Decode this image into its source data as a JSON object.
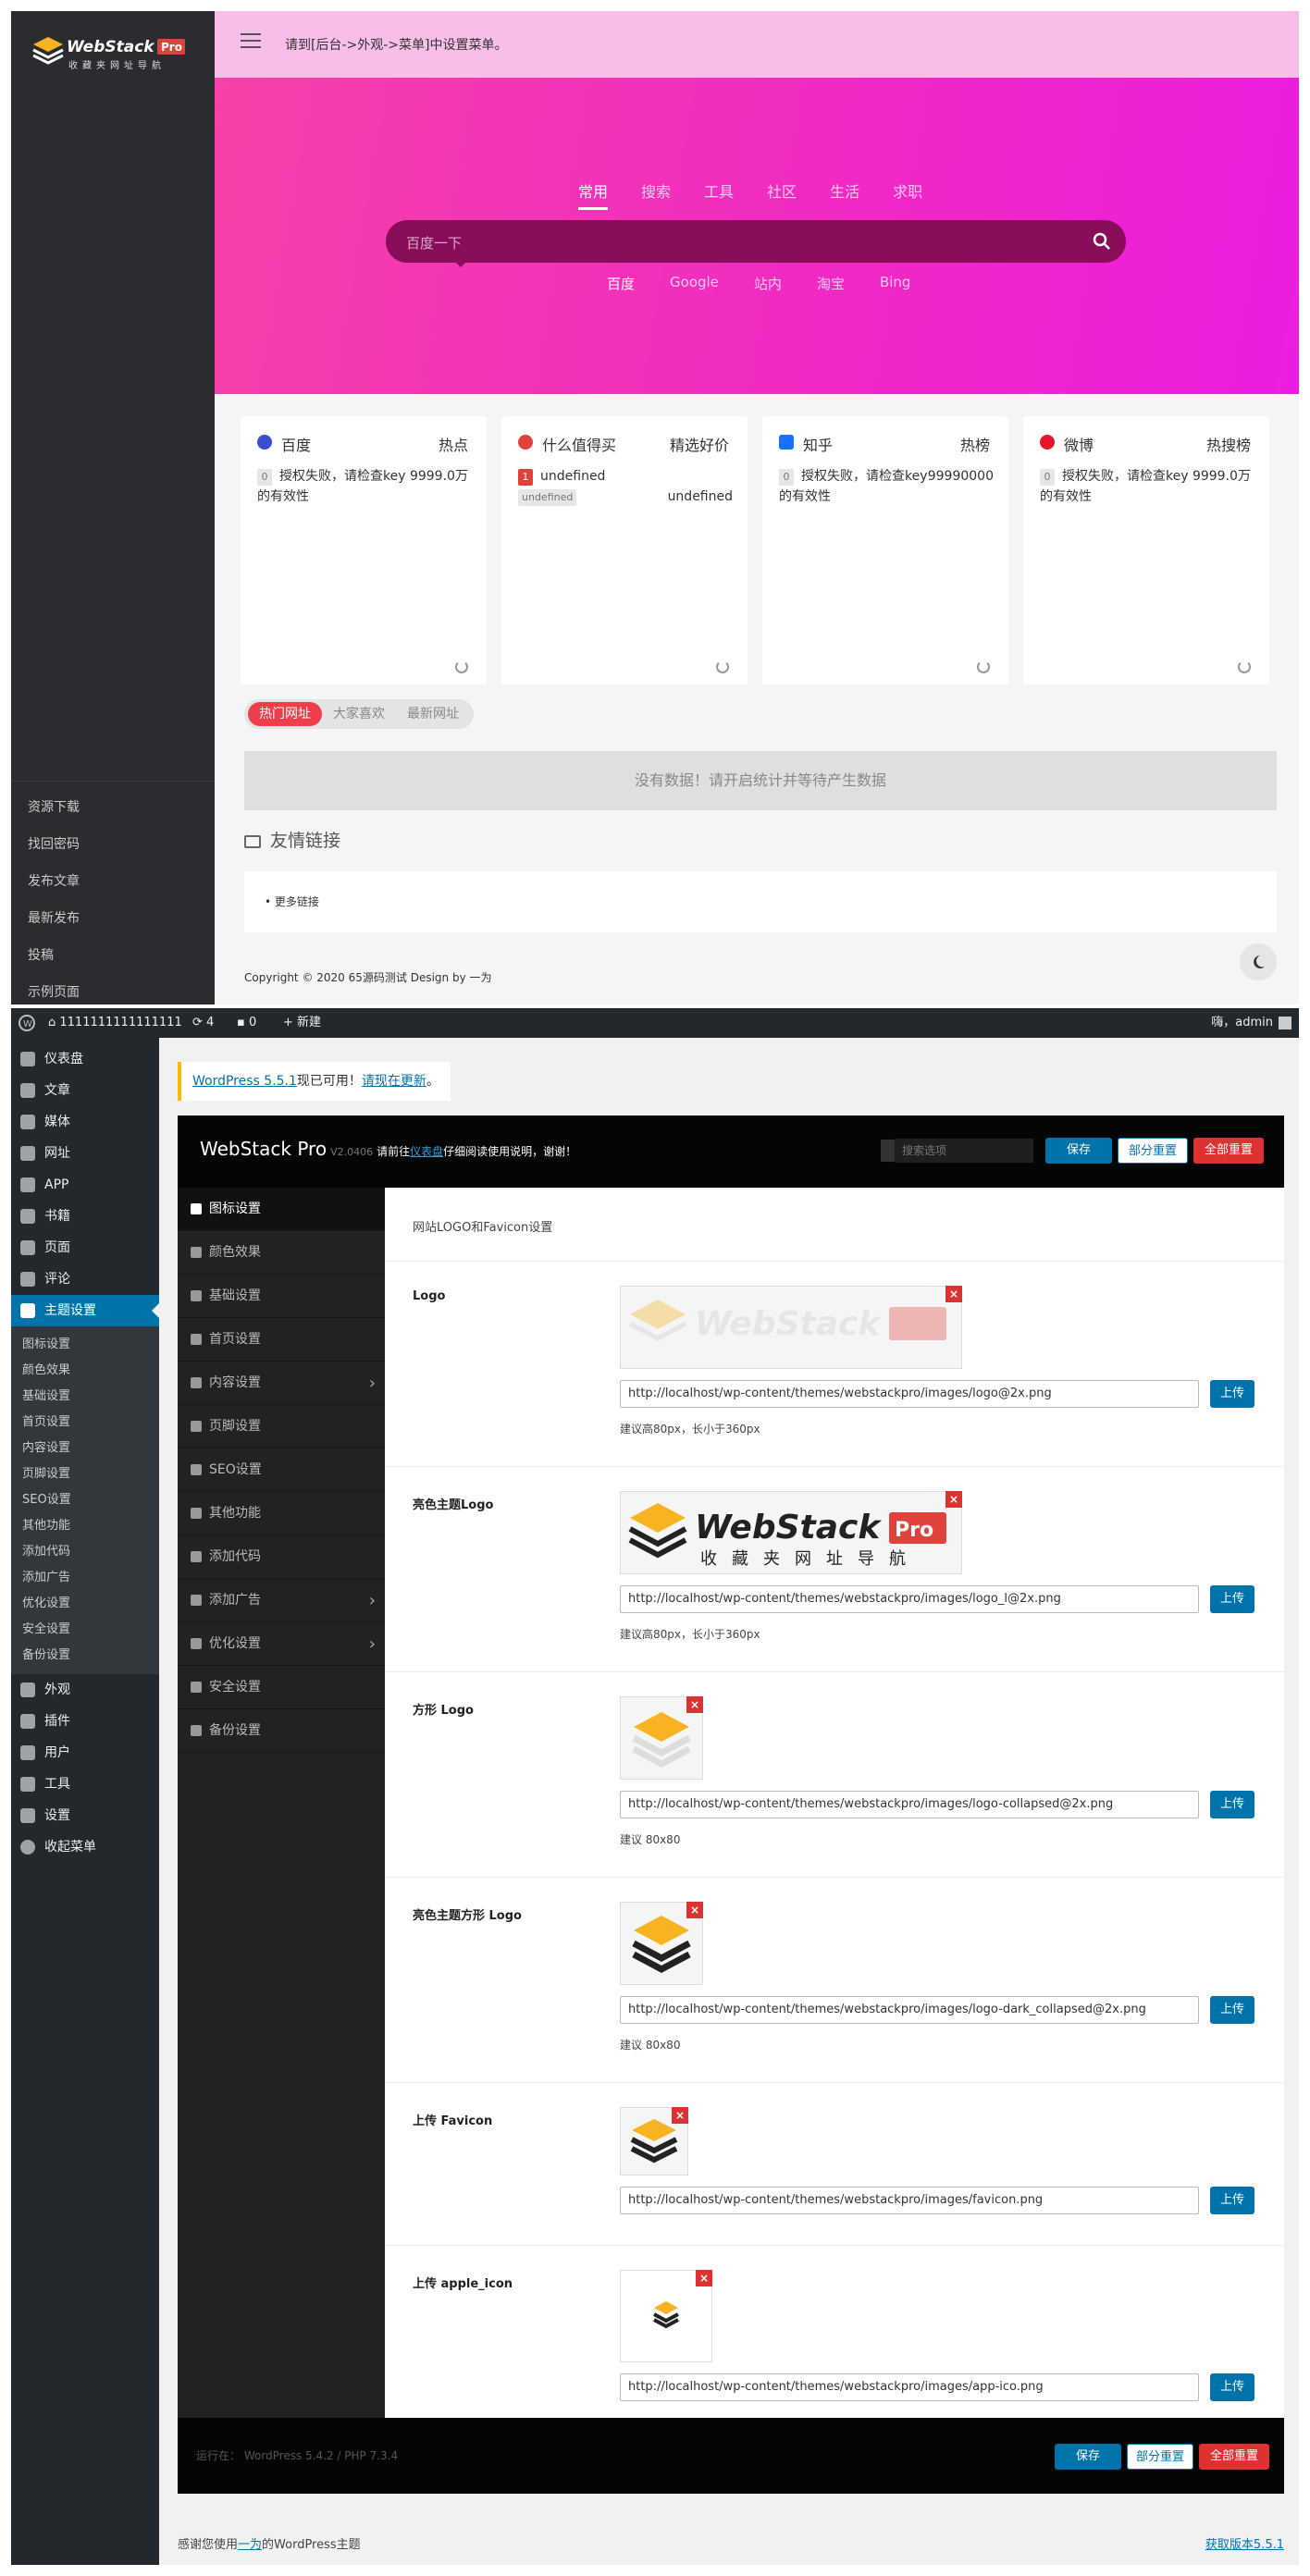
{
  "front": {
    "logo": {
      "brand": "WebStack",
      "badge": "Pro",
      "tagline": "收藏夹网址导航"
    },
    "sidebar_links": [
      "资源下载",
      "找回密码",
      "发布文章",
      "最新发布",
      "投稿",
      "示例页面"
    ],
    "header_notice": "请到[后台->外观->菜单]中设置菜单。",
    "search": {
      "tabs": [
        "常用",
        "搜索",
        "工具",
        "社区",
        "生活",
        "求职"
      ],
      "active_tab": "常用",
      "placeholder": "百度一下",
      "engines": [
        "百度",
        "Google",
        "站内",
        "淘宝",
        "Bing"
      ],
      "active_engine": "百度"
    },
    "hot_cards": [
      {
        "title": "百度",
        "tag": "热点",
        "num": "0",
        "text": "授权失败，请检查key 9999.0万的有效性",
        "icon_color": "#3a4ecf"
      },
      {
        "title": "什么值得买",
        "tag": "精选好价",
        "num": "1",
        "text": "undefined",
        "badge": "undefined",
        "right": "undefined",
        "icon_color": "#e0413b"
      },
      {
        "title": "知乎",
        "tag": "热榜",
        "num": "0",
        "text": "授权失败，请检查key的有效性",
        "right": "99990000",
        "icon_color": "#1772f6"
      },
      {
        "title": "微博",
        "tag": "热搜榜",
        "num": "0",
        "text": "授权失败，请检查key 9999.0万的有效性",
        "icon_color": "#e6162d"
      }
    ],
    "hot_tabs": [
      "热门网址",
      "大家喜欢",
      "最新网址"
    ],
    "active_hot_tab": "热门网址",
    "no_data": "没有数据！请开启统计并等待产生数据",
    "friend_title": "友情链接",
    "more_links": "• 更多链接",
    "footer": "Copyright © 2020 65源码测试   Design by 一为"
  },
  "admin": {
    "bar": {
      "site": "1111111111111111",
      "updates": "4",
      "comments": "0",
      "new": "新建",
      "greeting": "嗨，admin"
    },
    "menu": [
      "仪表盘",
      "文章",
      "媒体",
      "网址",
      "APP",
      "书籍",
      "页面",
      "评论",
      "主题设置"
    ],
    "menu_active": "主题设置",
    "submenu": [
      "图标设置",
      "颜色效果",
      "基础设置",
      "首页设置",
      "内容设置",
      "页脚设置",
      "SEO设置",
      "其他功能",
      "添加代码",
      "添加广告",
      "优化设置",
      "安全设置",
      "备份设置"
    ],
    "menu_after": [
      "外观",
      "插件",
      "用户",
      "工具",
      "设置",
      "收起菜单"
    ],
    "update_notice": {
      "link1": "WordPress 5.5.1",
      "mid": "现已可用！",
      "link2": "请现在更新",
      "end": "。"
    },
    "panel": {
      "title": "WebStack Pro",
      "version": "V2.0406",
      "desc_pre": "请前往",
      "desc_link": "仪表盘",
      "desc_post": "仔细阅读使用说明，谢谢！",
      "search_placeholder": "搜索选项",
      "save": "保存",
      "reset_section": "部分重置",
      "reset_all": "全部重置",
      "nav": [
        "图标设置",
        "颜色效果",
        "基础设置",
        "首页设置",
        "内容设置",
        "页脚设置",
        "SEO设置",
        "其他功能",
        "添加代码",
        "添加广告",
        "优化设置",
        "安全设置",
        "备份设置"
      ],
      "nav_active": "图标设置",
      "section_desc": "网站LOGO和Favicon设置",
      "upload": "上传",
      "fields": [
        {
          "label": "Logo",
          "url": "http://localhost/wp-content/themes/webstackpro/images/logo@2x.png",
          "hint": "建议高80px，长小于360px"
        },
        {
          "label": "亮色主题Logo",
          "url": "http://localhost/wp-content/themes/webstackpro/images/logo_l@2x.png",
          "hint": "建议高80px，长小于360px"
        },
        {
          "label": "方形 Logo",
          "url": "http://localhost/wp-content/themes/webstackpro/images/logo-collapsed@2x.png",
          "hint": "建议 80x80"
        },
        {
          "label": "亮色主题方形 Logo",
          "url": "http://localhost/wp-content/themes/webstackpro/images/logo-dark_collapsed@2x.png",
          "hint": "建议 80x80"
        },
        {
          "label": "上传 Favicon",
          "url": "http://localhost/wp-content/themes/webstackpro/images/favicon.png"
        },
        {
          "label": "上传 apple_icon",
          "url": "http://localhost/wp-content/themes/webstackpro/images/app-ico.png"
        }
      ],
      "status": "运行在： WordPress 5.4.2 / PHP 7.3.4"
    },
    "thanks": {
      "pre": "感谢您使用",
      "link": "一为",
      "post": "的WordPress主题"
    },
    "version_link": "获取版本5.5.1"
  }
}
